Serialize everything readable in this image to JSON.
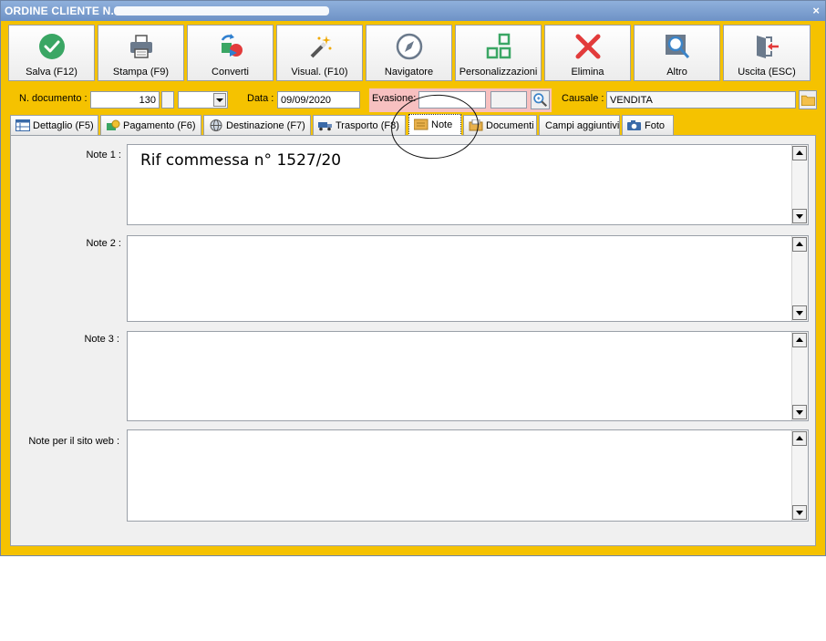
{
  "window": {
    "title": "ORDINE CLIENTE N.",
    "close_glyph": "×"
  },
  "toolbar": {
    "buttons": [
      {
        "label": "Salva (F12)",
        "icon": "check-icon",
        "color": "#3aa664"
      },
      {
        "label": "Stampa (F9)",
        "icon": "printer-icon"
      },
      {
        "label": "Converti",
        "icon": "convert-icon"
      },
      {
        "label": "Visual. (F10)",
        "icon": "magic-wand-icon"
      },
      {
        "label": "Navigatore",
        "icon": "compass-icon"
      },
      {
        "label": "Personalizzazioni",
        "icon": "grid-icon",
        "color": "#3aa664"
      },
      {
        "label": "Elimina",
        "icon": "delete-x-icon",
        "color": "#e23b3b"
      },
      {
        "label": "Altro",
        "icon": "search-icon"
      },
      {
        "label": "Uscita (ESC)",
        "icon": "exit-door-icon"
      }
    ]
  },
  "fields": {
    "ndoc_label": "N. documento :",
    "ndoc_value": "130",
    "data_label": "Data :",
    "data_value": "09/09/2020",
    "evasione_label": "Evasione:",
    "causale_label": "Causale :",
    "causale_value": "VENDITA"
  },
  "tabs": [
    {
      "label": "Dettaglio (F5)",
      "icon": "table-icon"
    },
    {
      "label": "Pagamento (F6)",
      "icon": "money-icon"
    },
    {
      "label": "Destinazione (F7)",
      "icon": "globe-icon"
    },
    {
      "label": "Trasporto (F8)",
      "icon": "truck-icon"
    },
    {
      "label": "Note",
      "icon": "note-icon",
      "active": true
    },
    {
      "label": "Documenti",
      "icon": "documents-icon"
    },
    {
      "label": "Campi aggiuntivi",
      "icon": ""
    },
    {
      "label": "Foto",
      "icon": "camera-icon"
    }
  ],
  "notes": [
    {
      "label": "Note 1 :",
      "value": "Rif commessa n°  1527/20"
    },
    {
      "label": "Note 2 :",
      "value": ""
    },
    {
      "label": "Note 3 :",
      "value": ""
    },
    {
      "label": "Note per il sito web :",
      "value": ""
    }
  ],
  "colors": {
    "frame": "#f5c200",
    "evasione_highlight": "#f7c0c0"
  }
}
